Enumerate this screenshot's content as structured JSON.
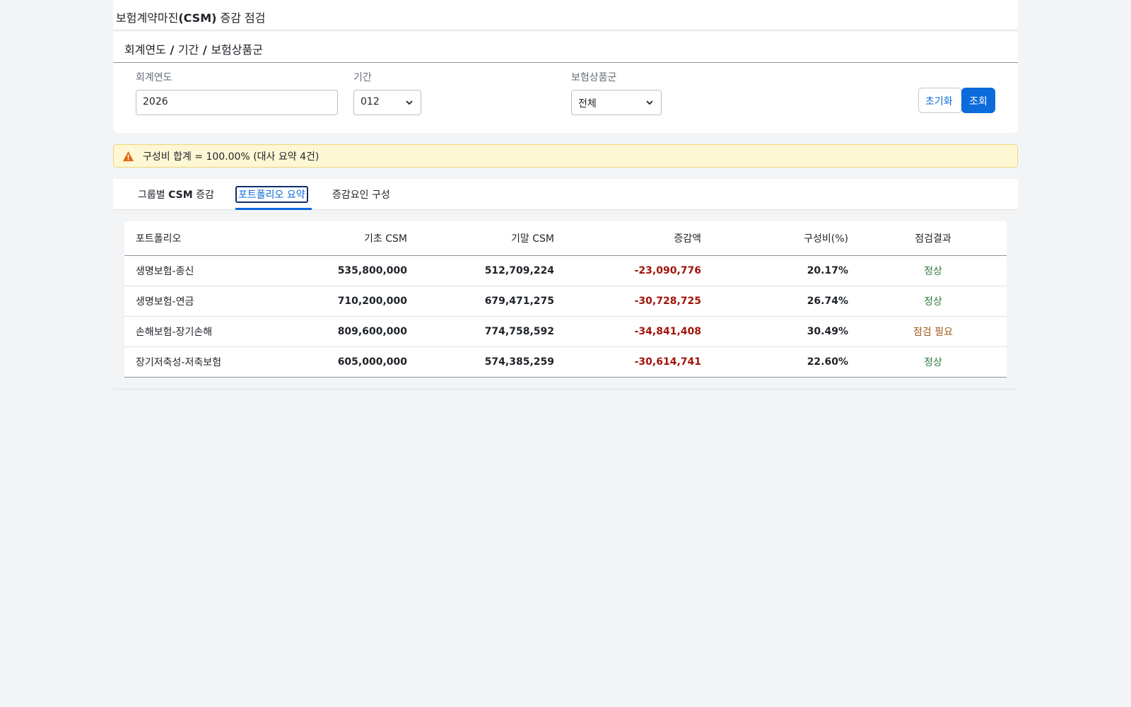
{
  "title": {
    "prefix": "보험계약마진",
    "bold": "(CSM)",
    "suffix": " 증감 점검"
  },
  "filter": {
    "heading_parts": [
      "회계연도",
      " / ",
      "기간",
      " / ",
      "보험상품군"
    ],
    "year_label": "회계연도",
    "year_value": "2026",
    "period_label": "기간",
    "period_value": "012",
    "group_label": "보험상품군",
    "group_value": "전체",
    "reset_label": "초기화",
    "search_label": "조회"
  },
  "alert": {
    "icon": "warning-icon",
    "color": "#e36209",
    "text": "구성비 합계 = 100.00% (대사 요약 4건)"
  },
  "tabs": [
    {
      "prefix": "그룹별 ",
      "bold": "CSM",
      "suffix": " 증감"
    },
    {
      "label": "포트폴리오 요약"
    },
    {
      "label": "증감요인 구성"
    }
  ],
  "table": {
    "headers": [
      "포트폴리오",
      "기초 CSM",
      "기말 CSM",
      "증감액",
      "구성비(%)",
      "점검결과"
    ],
    "rows": [
      [
        "생명보험-종신",
        "535,800,000",
        "512,709,224",
        "-23,090,776",
        "20.17%",
        "정상"
      ],
      [
        "생명보험-연금",
        "710,200,000",
        "679,471,275",
        "-30,728,725",
        "26.74%",
        "정상"
      ],
      [
        "손해보험-장기손해",
        "809,600,000",
        "774,758,592",
        "-34,841,408",
        "30.49%",
        "점검 필요"
      ],
      [
        "장기저축성-저축보험",
        "605,000,000",
        "574,385,259",
        "-30,614,741",
        "22.60%",
        "정상"
      ]
    ]
  },
  "colors": {
    "accent": "#0969da",
    "negative": "#a1140a",
    "ok": "#2f7a3d",
    "warn": "#a05a1a"
  }
}
